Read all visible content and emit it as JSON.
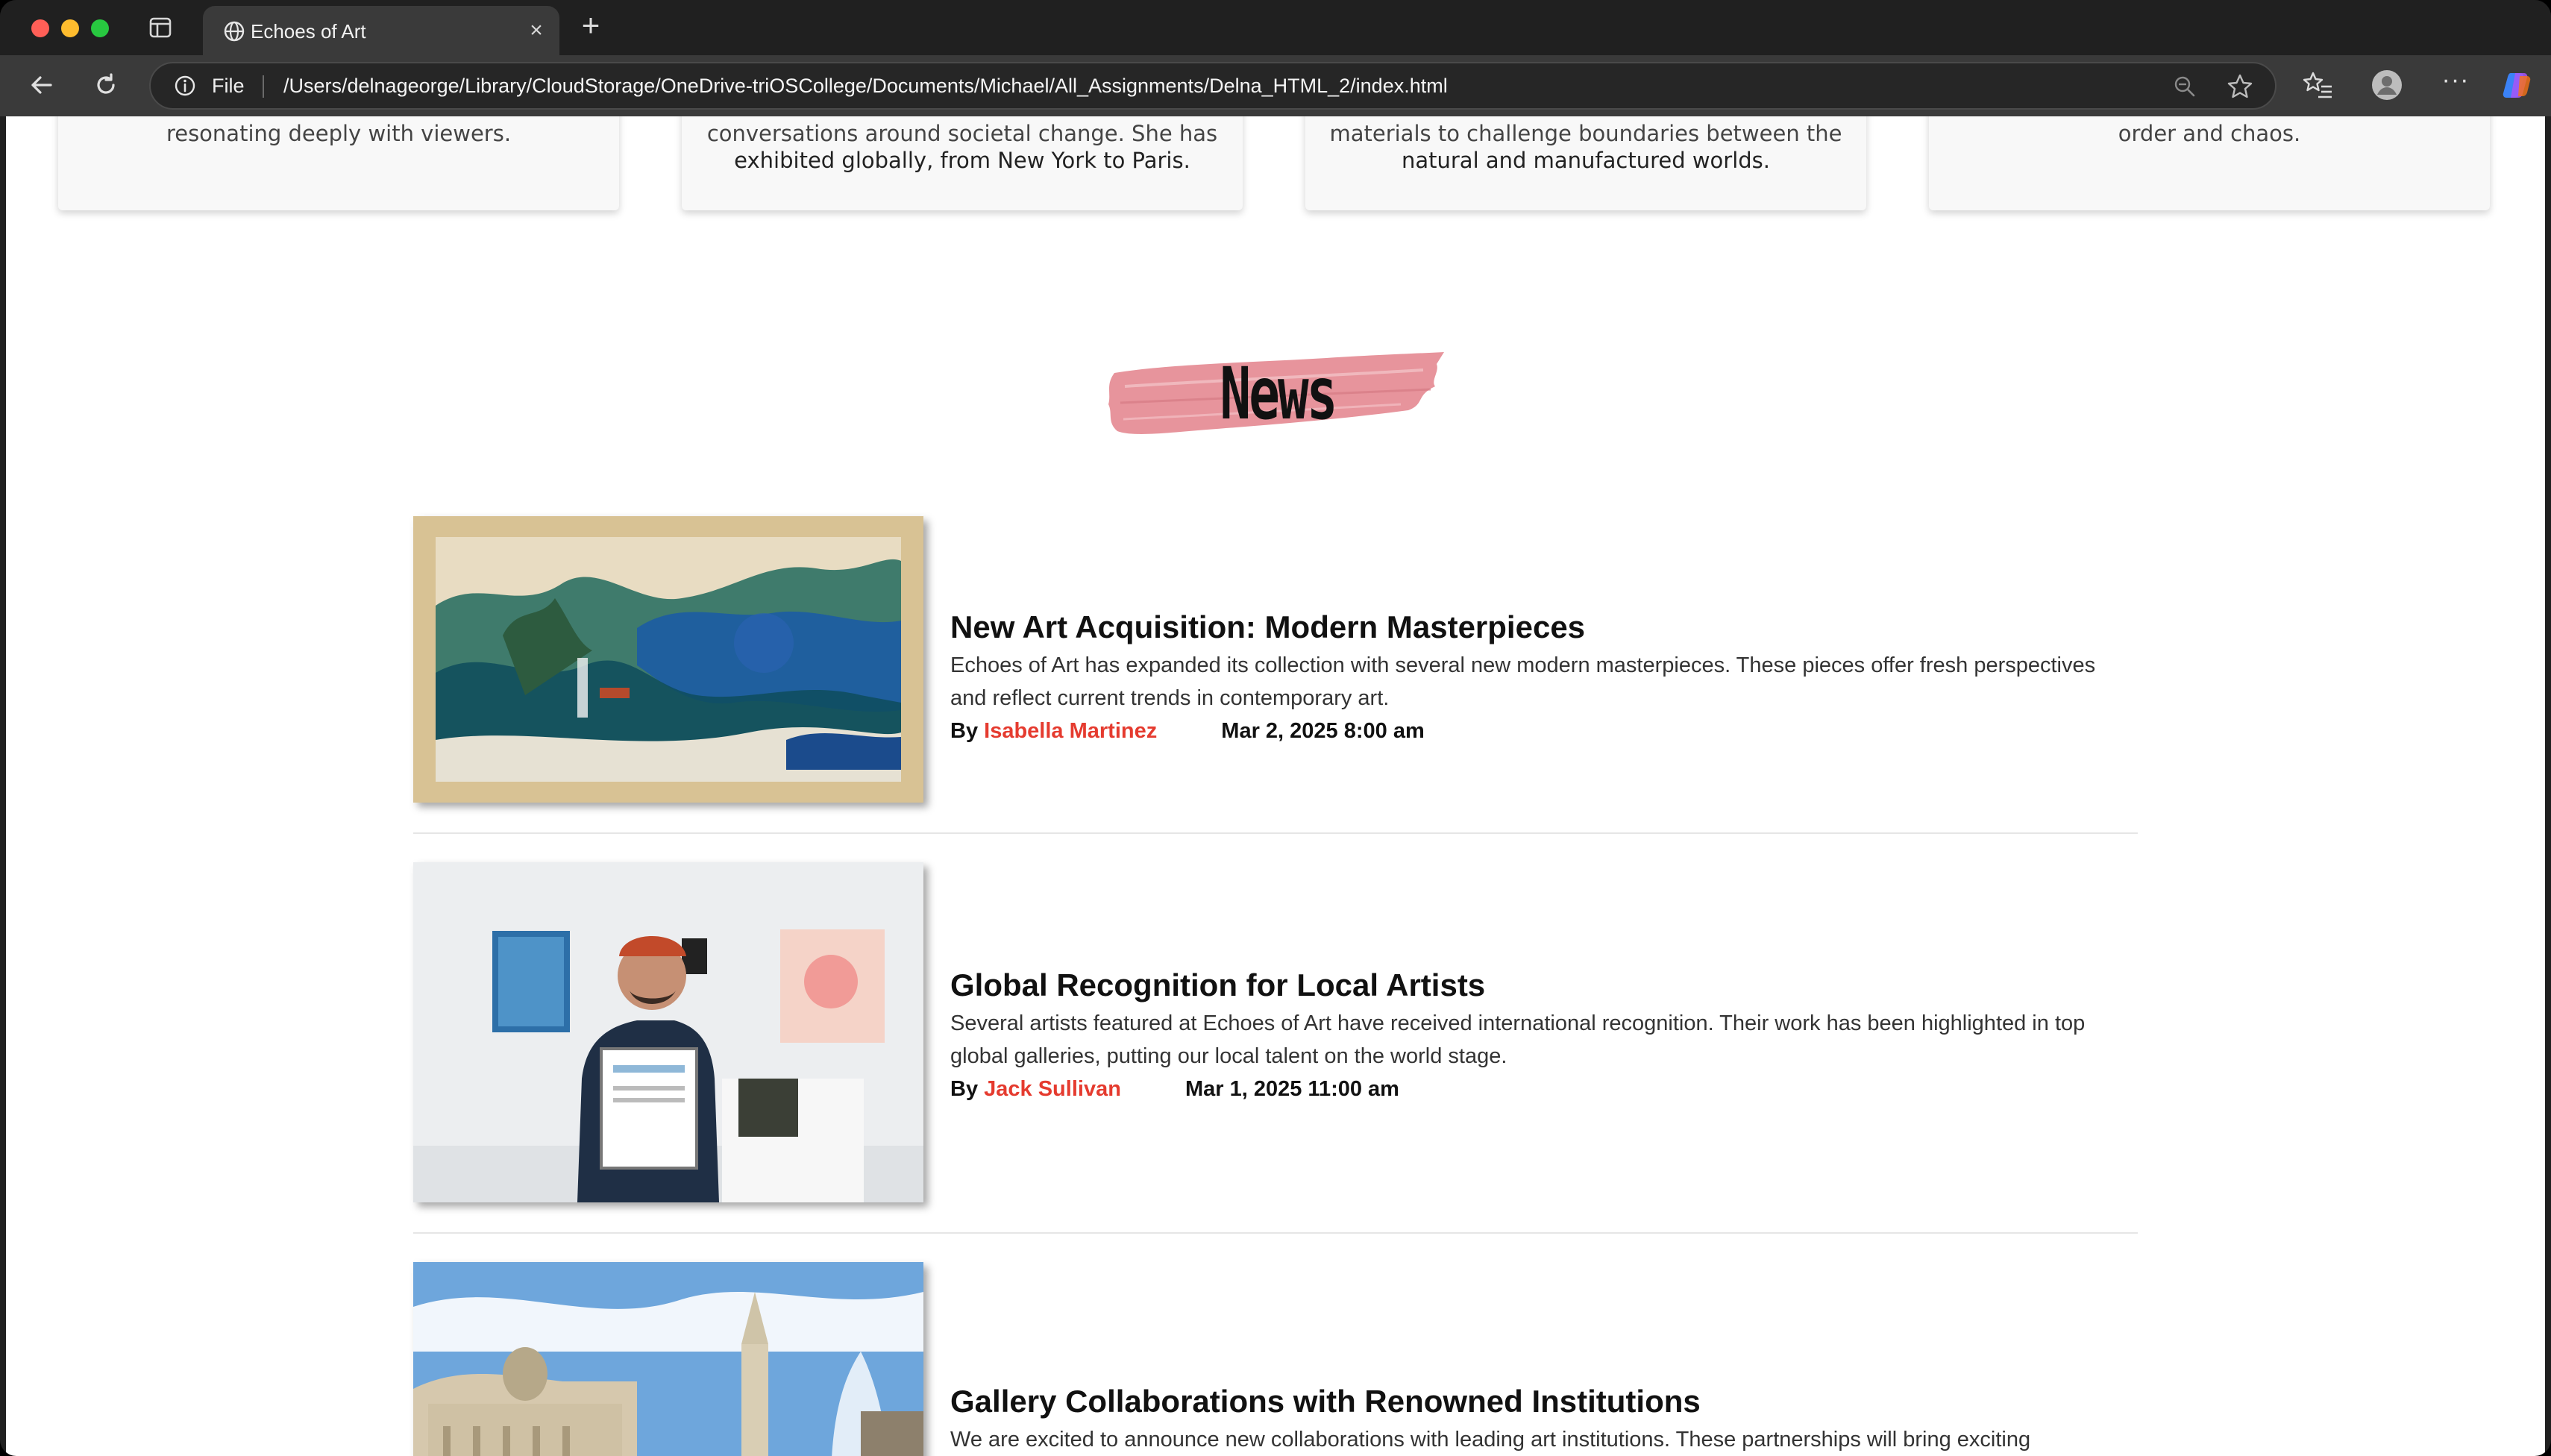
{
  "browser": {
    "tab_title": "Echoes of Art",
    "address_scheme": "File",
    "url": "/Users/delnageorge/Library/CloudStorage/OneDrive-triOSCollege/Documents/Michael/All_Assignments/Delna_HTML_2/index.html",
    "new_tab_label": "+",
    "close_tab_label": "×",
    "more_label": "···"
  },
  "artist_cards": [
    {
      "line1": "resonating deeply with viewers.",
      "line2": ""
    },
    {
      "line1": "conversations around societal change. She has",
      "line2": "exhibited globally, from New York to Paris."
    },
    {
      "line1": "materials to challenge boundaries between the",
      "line2": "natural and manufactured worlds."
    },
    {
      "line1": "order and chaos.",
      "line2": ""
    }
  ],
  "news": {
    "heading": "News",
    "brush_color": "#e7949c",
    "articles": [
      {
        "title": "New Art Acquisition: Modern Masterpieces",
        "summary": "Echoes of Art has expanded its collection with several new modern masterpieces. These pieces offer fresh perspectives and reflect current trends in contemporary art.",
        "by_label": "By",
        "author": "Isabella Martinez",
        "date": "Mar 2, 2025 8:00 am",
        "image": "landscape-painting"
      },
      {
        "title": "Global Recognition for Local Artists",
        "summary": "Several artists featured at Echoes of Art have received international recognition. Their work has been highlighted in top global galleries, putting our local talent on the world stage.",
        "by_label": "By",
        "author": "Jack Sullivan",
        "date": "Mar 1, 2025 11:00 am",
        "image": "artist-with-certificate"
      },
      {
        "title": "Gallery Collaborations with Renowned Institutions",
        "summary": "We are excited to announce new collaborations with leading art institutions. These partnerships will bring exciting",
        "image": "trafalgar-square-gallery"
      }
    ]
  },
  "colors": {
    "author_link": "#e53b2f",
    "chrome_bg": "#202020",
    "toolbar_bg": "#3a3a3a"
  }
}
